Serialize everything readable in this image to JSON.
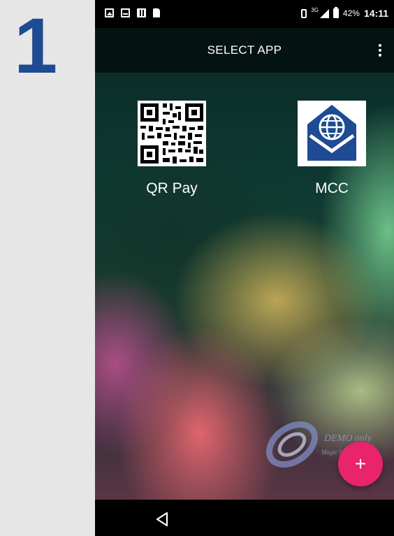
{
  "step": {
    "number": "1"
  },
  "status_bar": {
    "left_icons": [
      "image-icon",
      "inbox-icon",
      "calculator-icon",
      "sim-card-icon"
    ],
    "network": "3G",
    "battery_percent": "42%",
    "time": "14:11"
  },
  "app_bar": {
    "title": "SELECT APP",
    "menu_icon": "more-vertical-icon"
  },
  "apps": [
    {
      "label": "QR Pay",
      "icon": "qr-code-icon"
    },
    {
      "label": "MCC",
      "icon": "globe-envelope-icon"
    }
  ],
  "watermark": {
    "text": "DEMO only",
    "subtext": "Magic Software"
  },
  "fab": {
    "label": "+",
    "icon": "plus-icon",
    "color": "#e9246a"
  },
  "nav_bar": {
    "back_icon": "back-triangle-icon"
  },
  "colors": {
    "step_number": "#1e4b93",
    "app_bar": "#000000",
    "mcc_icon": "#1e4b93"
  }
}
